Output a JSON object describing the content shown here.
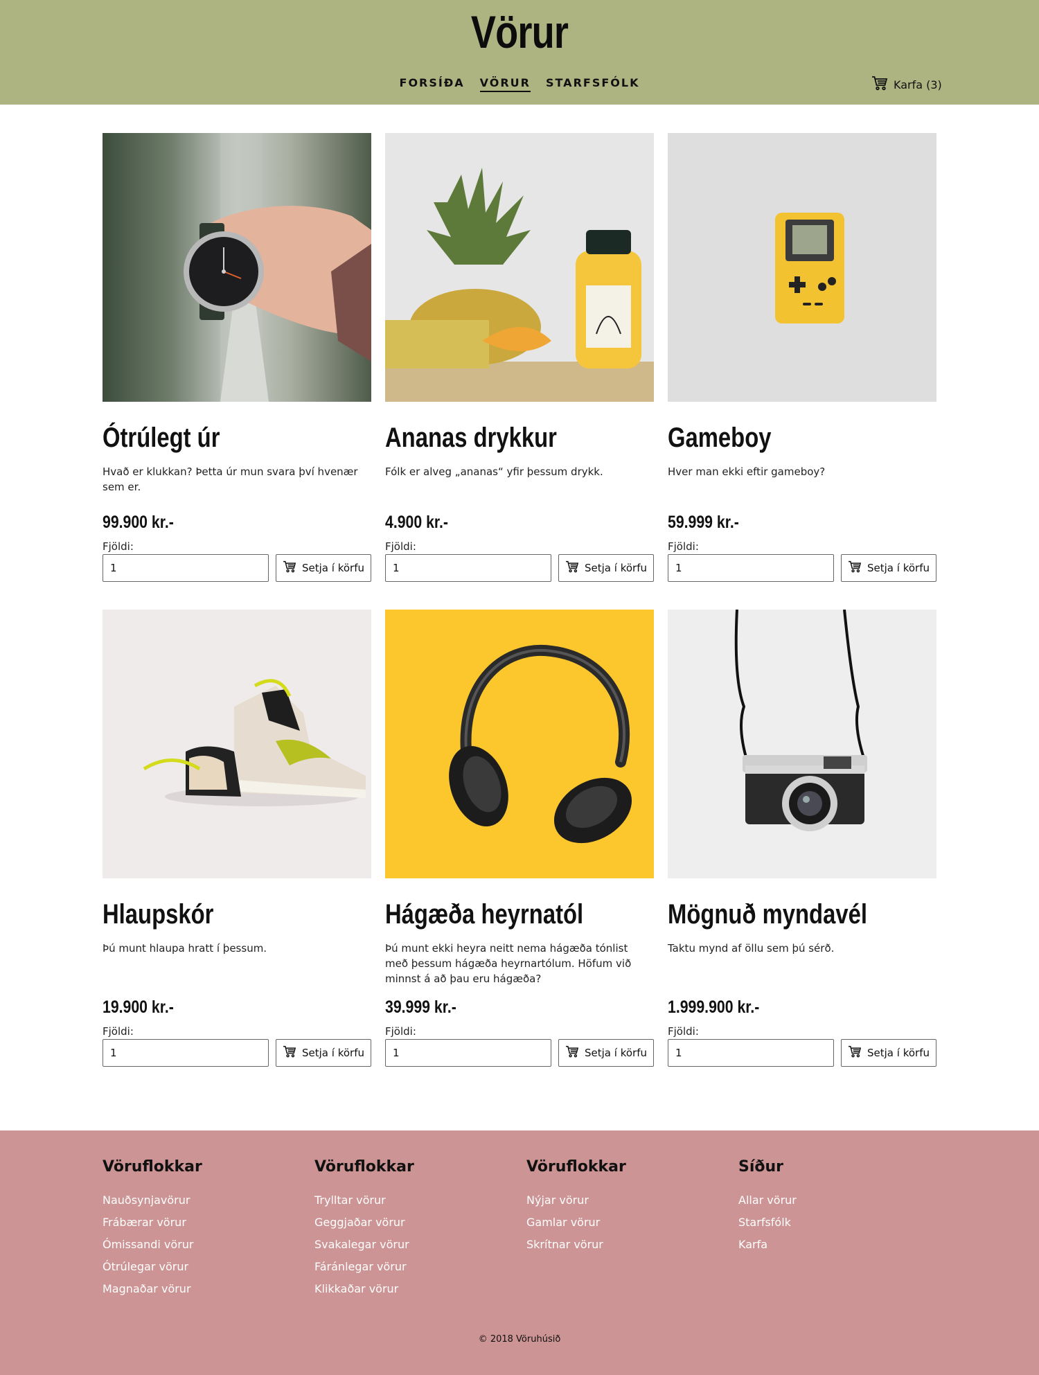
{
  "header": {
    "title": "Vörur",
    "nav": [
      {
        "label": "FORSÍÐA"
      },
      {
        "label": "VÖRUR"
      },
      {
        "label": "STARFSFÓLK"
      }
    ],
    "cart_label": "Karfa (3)"
  },
  "products": [
    {
      "name": "Ótrúlegt úr",
      "description": "Hvað er klukkan? Þetta úr mun svara því hvenær sem er.",
      "price": "99.900 kr.-",
      "qty_label": "Fjöldi:",
      "qty_value": "1",
      "button_label": "Setja í körfu"
    },
    {
      "name": "Ananas drykkur",
      "description": "Fólk er alveg „ananas“ yfir þessum drykk.",
      "price": "4.900 kr.-",
      "qty_label": "Fjöldi:",
      "qty_value": "1",
      "button_label": "Setja í körfu"
    },
    {
      "name": "Gameboy",
      "description": "Hver man ekki eftir gameboy?",
      "price": "59.999 kr.-",
      "qty_label": "Fjöldi:",
      "qty_value": "1",
      "button_label": "Setja í körfu"
    },
    {
      "name": "Hlaupskór",
      "description": "Þú munt hlaupa hratt í þessum.",
      "price": "19.900 kr.-",
      "qty_label": "Fjöldi:",
      "qty_value": "1",
      "button_label": "Setja í körfu"
    },
    {
      "name": "Hágæða heyrnatól",
      "description": "Þú munt ekki heyra neitt nema hágæða tónlist með þessum hágæða heyrnartólum. Höfum við minnst á að þau eru hágæða?",
      "price": "39.999 kr.-",
      "qty_label": "Fjöldi:",
      "qty_value": "1",
      "button_label": "Setja í körfu"
    },
    {
      "name": "Mögnuð myndavél",
      "description": "Taktu mynd af öllu sem þú sérð.",
      "price": "1.999.900 kr.-",
      "qty_label": "Fjöldi:",
      "qty_value": "1",
      "button_label": "Setja í körfu"
    }
  ],
  "footer": {
    "columns": [
      {
        "heading": "Vöruflokkar",
        "links": [
          "Nauðsynjavörur",
          "Frábærar vörur",
          "Ómissandi vörur",
          "Ótrúlegar vörur",
          "Magnaðar vörur"
        ]
      },
      {
        "heading": "Vöruflokkar",
        "links": [
          "Trylltar vörur",
          "Geggjaðar vörur",
          "Svakalegar vörur",
          "Fáránlegar vörur",
          "Klikkaðar vörur"
        ]
      },
      {
        "heading": "Vöruflokkar",
        "links": [
          "Nýjar vörur",
          "Gamlar vörur",
          "Skrítnar vörur"
        ]
      },
      {
        "heading": "Síður",
        "links": [
          "Allar vörur",
          "Starfsfólk",
          "Karfa"
        ]
      }
    ],
    "copyright": "© 2018 Vöruhúsið"
  },
  "colors": {
    "header_bg": "#adb482",
    "footer_bg": "#cc9494",
    "footer_link": "#ffffff"
  },
  "icons": {
    "cart": "shopping-cart-icon"
  }
}
